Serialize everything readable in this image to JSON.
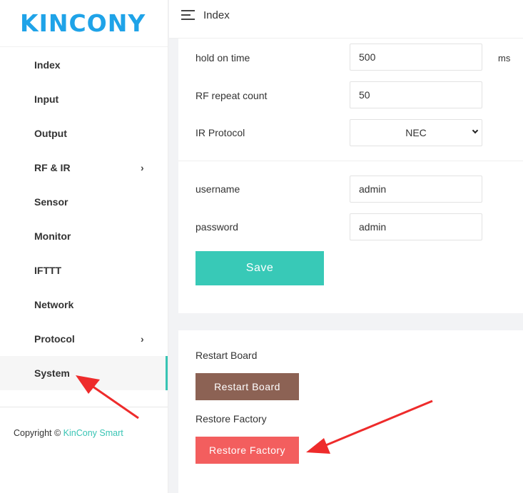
{
  "brand": {
    "logo_text": "KINCONY",
    "logo_color": "#1fa3e8"
  },
  "sidebar": {
    "items": [
      {
        "label": "Index",
        "has_submenu": false,
        "active": false
      },
      {
        "label": "Input",
        "has_submenu": false,
        "active": false
      },
      {
        "label": "Output",
        "has_submenu": false,
        "active": false
      },
      {
        "label": "RF & IR",
        "has_submenu": true,
        "active": false
      },
      {
        "label": "Sensor",
        "has_submenu": false,
        "active": false
      },
      {
        "label": "Monitor",
        "has_submenu": false,
        "active": false
      },
      {
        "label": "IFTTT",
        "has_submenu": false,
        "active": false
      },
      {
        "label": "Network",
        "has_submenu": false,
        "active": false
      },
      {
        "label": "Protocol",
        "has_submenu": true,
        "active": false
      },
      {
        "label": "System",
        "has_submenu": false,
        "active": true
      }
    ],
    "copyright_prefix": "Copyright ©",
    "copyright_brand": "KinCony Smart",
    "accent_color": "#38c4b4"
  },
  "header": {
    "menu_icon": "menu-icon",
    "title": "Index"
  },
  "settings": {
    "hold_on_time": {
      "label": "hold on time",
      "value": "500",
      "unit": "ms"
    },
    "rf_repeat_count": {
      "label": "RF repeat count",
      "value": "50"
    },
    "ir_protocol": {
      "label": "IR Protocol",
      "selected": "NEC"
    },
    "username": {
      "label": "username",
      "value": "admin"
    },
    "password": {
      "label": "password",
      "value": "admin"
    },
    "save_label": "Save",
    "save_color": "#38c9b7"
  },
  "system": {
    "restart_title": "Restart Board",
    "restart_button": "Restart Board",
    "restart_color": "#8c6254",
    "restore_title": "Restore Factory",
    "restore_button": "Restore Factory",
    "restore_color": "#f35e5e"
  },
  "annotations": {
    "arrow_color": "#ee2b2b"
  }
}
